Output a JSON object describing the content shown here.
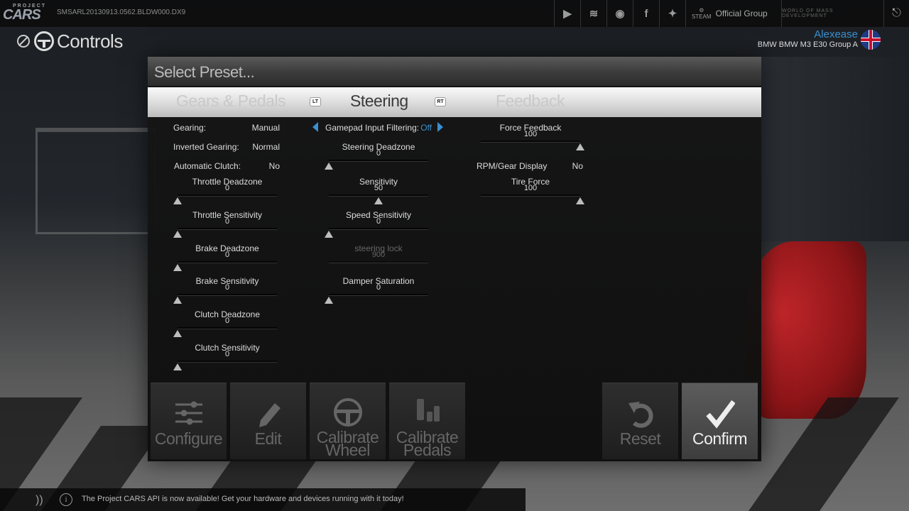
{
  "topbar": {
    "logo_small": "PROJECT",
    "logo": "CARS",
    "build": "SMSARL20130913.0562.BLDW000.DX9",
    "social_icons": [
      "youtube-icon",
      "spotify-icon",
      "podcast-icon",
      "facebook-icon",
      "twitter-icon"
    ],
    "steam_label": "STEAM",
    "official_group": "Official Group",
    "wmd_label": "WORLD OF MASS DEVELOPMENT"
  },
  "header": {
    "title": "Controls"
  },
  "user": {
    "name": "Alexease",
    "car": "BMW BMW M3 E30 Group A"
  },
  "preset": {
    "label": "Select Preset..."
  },
  "tabs": {
    "gears": "Gears & Pedals",
    "steering": "Steering",
    "feedback": "Feedback",
    "lt": "LT",
    "rt": "RT"
  },
  "gears": {
    "gearing_label": "Gearing:",
    "gearing_value": "Manual",
    "inverted_label": "Inverted Gearing:",
    "inverted_value": "Normal",
    "clutch_label": "Automatic Clutch:",
    "clutch_value": "No",
    "sliders": [
      {
        "name": "Throttle Deadzone",
        "value": "0"
      },
      {
        "name": "Throttle Sensitivity",
        "value": "0"
      },
      {
        "name": "Brake Deadzone",
        "value": "0"
      },
      {
        "name": "Brake Sensitivity",
        "value": "0"
      },
      {
        "name": "Clutch Deadzone",
        "value": "0"
      },
      {
        "name": "Clutch Sensitivity",
        "value": "0"
      }
    ]
  },
  "steering": {
    "filter_label": "Gamepad Input Filtering:",
    "filter_value": "Off",
    "sliders": [
      {
        "name": "Steering Deadzone",
        "value": "0"
      },
      {
        "name": "Sensitivity",
        "value": "50"
      },
      {
        "name": "Speed Sensitivity",
        "value": "0"
      },
      {
        "name": "steering lock",
        "value": "900"
      },
      {
        "name": "Damper Saturation",
        "value": "0"
      }
    ]
  },
  "feedback": {
    "force_name": "Force Feedback",
    "force_value": "100",
    "rpm_label": "RPM/Gear Display",
    "rpm_value": "No",
    "tire_name": "Tire Force",
    "tire_value": "100"
  },
  "slider_levels": {
    "gears": [
      0,
      0,
      0,
      0,
      0,
      0
    ],
    "steering": [
      0,
      0.5,
      0,
      0,
      0
    ],
    "force_feedback": 1.0,
    "tire_force": 1.0
  },
  "actions": {
    "configure": "Configure",
    "edit": "Edit",
    "calibrate_wheel_1": "Calibrate",
    "calibrate_wheel_2": "Wheel",
    "calibrate_pedals_1": "Calibrate",
    "calibrate_pedals_2": "Pedals",
    "reset": "Reset",
    "confirm": "Confirm"
  },
  "ticker": {
    "message": "The Project CARS API is now available! Get your hardware and devices running with it today!"
  },
  "colors": {
    "accent": "#3a8fd0",
    "active_tab_text": "#3a3a3a",
    "inactive_tab_text": "#c9c9c9"
  }
}
